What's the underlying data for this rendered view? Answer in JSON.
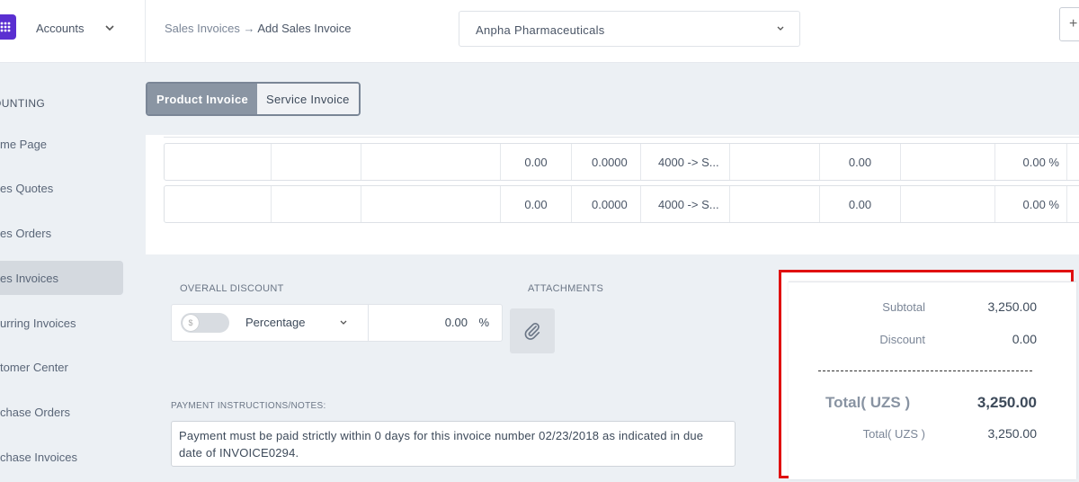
{
  "header": {
    "app_label": "Accounts",
    "breadcrumb_parent": "Sales Invoices",
    "breadcrumb_arrow": "→",
    "breadcrumb_current": "Add Sales Invoice",
    "company": "Anpha Pharmaceuticals",
    "plus_label": "+"
  },
  "sidebar": {
    "section": "OUNTING",
    "items": [
      {
        "label": "me Page"
      },
      {
        "label": "es Quotes"
      },
      {
        "label": "es Orders"
      },
      {
        "label": "es Invoices",
        "active": true
      },
      {
        "label": "urring Invoices"
      },
      {
        "label": "tomer Center"
      },
      {
        "label": "chase Orders"
      },
      {
        "label": "chase Invoices"
      }
    ]
  },
  "tabs": {
    "product": "Product Invoice",
    "service": "Service Invoice"
  },
  "rows": [
    {
      "amount": "0.00",
      "rate": "0.0000",
      "account": "4000 -> S...",
      "value": "0.00",
      "tax": "0.00 %"
    },
    {
      "amount": "0.00",
      "rate": "0.0000",
      "account": "4000 -> S...",
      "value": "0.00",
      "tax": "0.00 %"
    }
  ],
  "discount": {
    "label": "OVERALL DISCOUNT",
    "type": "Percentage",
    "value": "0.00",
    "unit": "%"
  },
  "attachments": {
    "label": "ATTACHMENTS"
  },
  "notes": {
    "label": "PAYMENT INSTRUCTIONS/NOTES:",
    "text": "Payment must be paid strictly within 0 days for this invoice number 02/23/2018 as indicated in due date of INVOICE0294."
  },
  "totals": {
    "subtotal_label": "Subtotal",
    "subtotal_value": "3,250.00",
    "discount_label": "Discount",
    "discount_value": "0.00",
    "total_label": "Total( UZS )",
    "total_value": "3,250.00",
    "total2_label": "Total( UZS )",
    "total2_value": "3,250.00"
  },
  "colors": {
    "accent": "#5a2fd1",
    "highlight": "#e01010",
    "tab_active": "#8a95a3"
  }
}
